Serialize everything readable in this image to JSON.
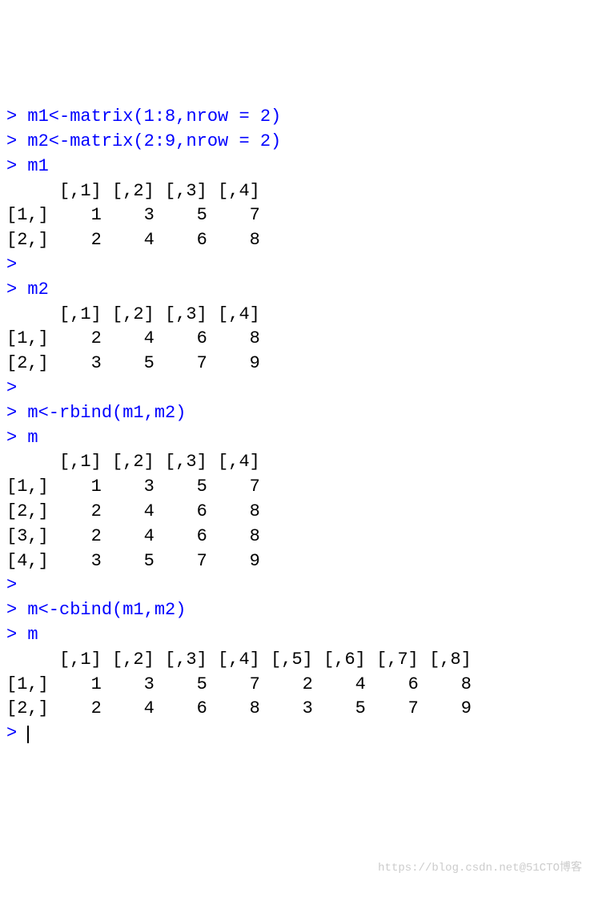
{
  "lines": [
    {
      "prompt": ">",
      "code": " m1<-matrix(1:8,nrow = 2)"
    },
    {
      "prompt": ">",
      "code": " m2<-matrix(2:9,nrow = 2)"
    },
    {
      "prompt": ">",
      "code": " m1"
    },
    {
      "output": "     [,1] [,2] [,3] [,4]"
    },
    {
      "output": "[1,]    1    3    5    7"
    },
    {
      "output": "[2,]    2    4    6    8"
    },
    {
      "prompt": ">",
      "code": " "
    },
    {
      "prompt": ">",
      "code": " m2"
    },
    {
      "output": "     [,1] [,2] [,3] [,4]"
    },
    {
      "output": "[1,]    2    4    6    8"
    },
    {
      "output": "[2,]    3    5    7    9"
    },
    {
      "prompt": ">",
      "code": " "
    },
    {
      "prompt": ">",
      "code": " m<-rbind(m1,m2)"
    },
    {
      "prompt": ">",
      "code": " m"
    },
    {
      "output": "     [,1] [,2] [,3] [,4]"
    },
    {
      "output": "[1,]    1    3    5    7"
    },
    {
      "output": "[2,]    2    4    6    8"
    },
    {
      "output": "[3,]    2    4    6    8"
    },
    {
      "output": "[4,]    3    5    7    9"
    },
    {
      "prompt": ">",
      "code": " "
    },
    {
      "prompt": ">",
      "code": " m<-cbind(m1,m2)"
    },
    {
      "prompt": ">",
      "code": " m"
    },
    {
      "output": "     [,1] [,2] [,3] [,4] [,5] [,6] [,7] [,8]"
    },
    {
      "output": "[1,]    1    3    5    7    2    4    6    8"
    },
    {
      "output": "[2,]    2    4    6    8    3    5    7    9"
    },
    {
      "prompt": ">",
      "code": " ",
      "cursor": true
    }
  ],
  "watermark": "https://blog.csdn.net@51CTO博客"
}
